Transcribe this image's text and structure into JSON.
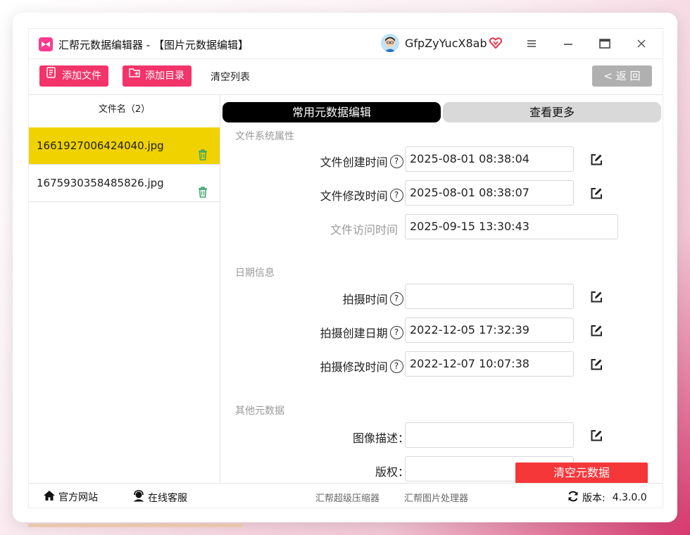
{
  "app": {
    "title": "汇帮元数据编辑器 - 【图片元数据编辑】",
    "username": "GfpZyYucX8ab"
  },
  "toolbar": {
    "add_file": "添加文件",
    "add_dir": "添加目录",
    "clear_list": "清空列表",
    "back": "返 回",
    "back_arrow": "<"
  },
  "file_list": {
    "header": "文件名（2）",
    "files": [
      "1661927006424040.jpg",
      "1675930358485826.jpg"
    ]
  },
  "tabs": {
    "common": "常用元数据编辑",
    "more": "查看更多"
  },
  "sections": {
    "fs": "文件系统属性",
    "date": "日期信息",
    "other": "其他元数据"
  },
  "fields": {
    "create_time": {
      "label": "文件创建时间",
      "value": "2025-08-01 08:38:04"
    },
    "modify_time": {
      "label": "文件修改时间",
      "value": "2025-08-01 08:38:07"
    },
    "access_time": {
      "label": "文件访问时间",
      "value": "2025-09-15 13:30:43"
    },
    "shoot_time": {
      "label": "拍摄时间",
      "value": ""
    },
    "shoot_create": {
      "label": "拍摄创建日期",
      "value": "2022-12-05 17:32:39"
    },
    "shoot_modify": {
      "label": "拍摄修改时间",
      "value": "2022-12-07 10:07:38"
    },
    "image_desc": {
      "label": "图像描述",
      "value": ""
    },
    "copyright": {
      "label": "版权",
      "value": ""
    }
  },
  "colon": ":",
  "colon_full": "：",
  "help_mark": "?",
  "actions": {
    "clear_metadata": "清空元数据"
  },
  "footer": {
    "website": "官方网站",
    "support": "在线客服",
    "compressor": "汇帮超级压缩器",
    "image_tool": "汇帮图片处理器",
    "version_label": "版本:",
    "version": "4.3.0.0"
  },
  "colors": {
    "accent_pink": "#f2346a",
    "selected_row": "#f0d200",
    "danger_red": "#f5373a",
    "trash_green": "#3aa56b"
  },
  "icons": [
    "file-add-icon",
    "folder-add-icon",
    "trash-icon",
    "help-icon",
    "edit-icon",
    "home-icon",
    "support-icon",
    "refresh-icon",
    "menu-icon",
    "minimize-icon",
    "maximize-icon",
    "close-icon",
    "vip-heart-icon"
  ]
}
